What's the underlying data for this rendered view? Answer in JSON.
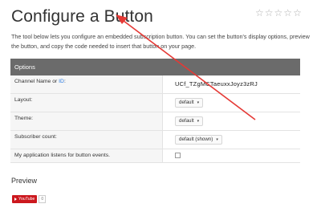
{
  "page": {
    "title": "Configure a Button",
    "intro": "The tool below lets you configure an embedded subscription button. You can set the button's display options, preview the button, and copy the code needed to insert that button on your page."
  },
  "rating": {
    "stars": [
      "☆",
      "☆",
      "☆",
      "☆",
      "☆"
    ]
  },
  "options": {
    "header": "Options",
    "channel": {
      "label_prefix": "Channel Name or ",
      "label_link": "ID",
      "label_suffix": ":",
      "value": "UCf_TZgMCTaeuxxJoyz3zRJ"
    },
    "layout": {
      "label": "Layout:",
      "selected": "default"
    },
    "theme": {
      "label": "Theme:",
      "selected": "default"
    },
    "subscriber_count": {
      "label": "Subscriber count:",
      "selected": "default (shown)"
    },
    "events": {
      "label": "My application listens for button events."
    }
  },
  "preview": {
    "title": "Preview",
    "button_label": "YouTube",
    "count": "0"
  },
  "colors": {
    "header_bg": "#6b6b6b",
    "annotation_arrow": "#e53935",
    "youtube_red": "#cc181e",
    "link": "#2a7ae2"
  },
  "icons": {
    "dropdown": "▾",
    "play": "play-triangle"
  }
}
